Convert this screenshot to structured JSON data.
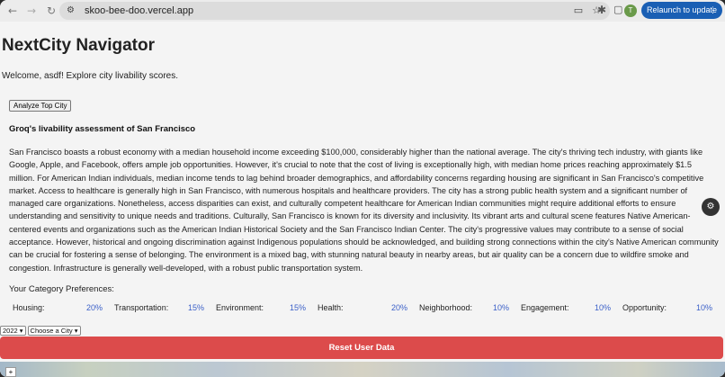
{
  "browser": {
    "url": "skoo-bee-doo.vercel.app",
    "relaunch_label": "Relaunch to update",
    "profile_initial": "T"
  },
  "icons": {
    "back": "←",
    "forward": "→",
    "reload": "↻",
    "site_settings": "⚙",
    "cast": "▭",
    "bookmark": "☆",
    "extensions": "✱",
    "tab_search": "▢",
    "menu": "⋮",
    "float": "⚙",
    "map_zoom": "+"
  },
  "app": {
    "title": "NextCity Navigator",
    "welcome": "Welcome, asdf! Explore city livability scores.",
    "analyze_button": "Analyze Top City",
    "assessment_title": "Groq's livability assessment of San Francisco",
    "assessment_text": "San Francisco boasts a robust economy with a median household income exceeding $100,000, considerably higher than the national average. The city's thriving tech industry, with giants like Google, Apple, and Facebook, offers ample job opportunities. However, it's crucial to note that the cost of living is exceptionally high, with median home prices reaching approximately $1.5 million. For American Indian individuals, median income tends to lag behind broader demographics, and affordability concerns regarding housing are significant in San Francisco's competitive market. Access to healthcare is generally high in San Francisco, with numerous hospitals and healthcare providers. The city has a strong public health system and a significant number of managed care organizations. Nonetheless, access disparities can exist, and culturally competent healthcare for American Indian communities might require additional efforts to ensure understanding and sensitivity to unique needs and traditions. Culturally, San Francisco is known for its diversity and inclusivity. Its vibrant arts and cultural scene features Native American-centered events and organizations such as the American Indian Historical Society and the San Francisco Indian Center. The city's progressive values may contribute to a sense of social acceptance. However, historical and ongoing discrimination against Indigenous populations should be acknowledged, and building strong connections within the city's Native American community can be crucial for fostering a sense of belonging. The environment is a mixed bag, with stunning natural beauty in nearby areas, but air quality can be a concern due to wildfire smoke and congestion. Infrastructure is generally well-developed, with a robust public transportation system.",
    "preferences_title": "Your Category Preferences:",
    "preferences": [
      {
        "label": "Housing:",
        "value": "20%"
      },
      {
        "label": "Transportation:",
        "value": "15%"
      },
      {
        "label": "Environment:",
        "value": "15%"
      },
      {
        "label": "Health:",
        "value": "20%"
      },
      {
        "label": "Neighborhood:",
        "value": "10%"
      },
      {
        "label": "Engagement:",
        "value": "10%"
      },
      {
        "label": "Opportunity:",
        "value": "10%"
      }
    ],
    "year_select": "2022",
    "city_select": "Choose a City",
    "reset_button": "Reset User Data"
  }
}
